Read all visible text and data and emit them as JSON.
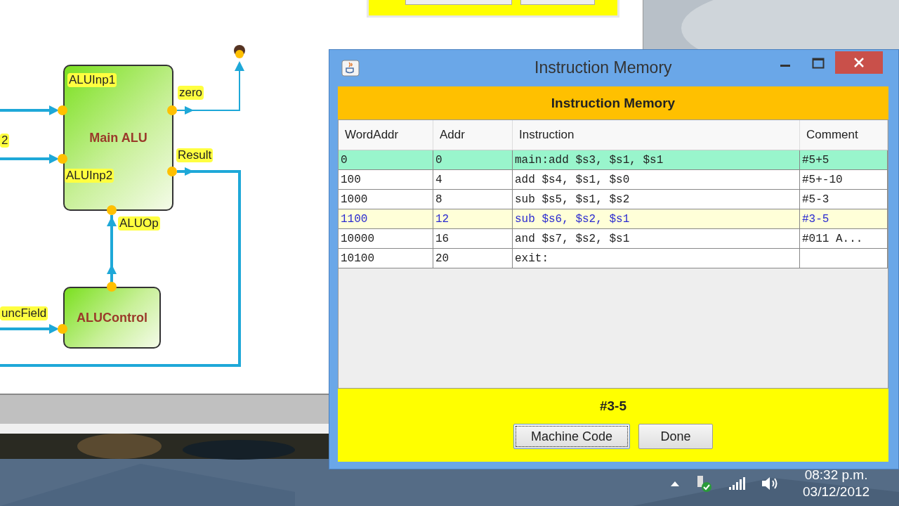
{
  "diagram": {
    "blocks": [
      {
        "label": "Main ALU"
      },
      {
        "label": "ALUControl"
      }
    ],
    "ports": [
      {
        "label": "2"
      },
      {
        "label": "ALUInp1"
      },
      {
        "label": "ALUInp2"
      },
      {
        "label": "zero"
      },
      {
        "label": "Result"
      },
      {
        "label": "ALUOp"
      },
      {
        "label": "uncField"
      }
    ]
  },
  "window": {
    "title": "Instruction Memory"
  },
  "header": "Instruction Memory",
  "table": {
    "columns": [
      "WordAddr",
      "Addr",
      "Instruction",
      "Comment"
    ],
    "rows": [
      {
        "cells": [
          "0",
          "0",
          "main:add $s3, $s1, $s1",
          "#5+5"
        ],
        "current": true,
        "selected": false
      },
      {
        "cells": [
          "100",
          "4",
          "add $s4, $s1, $s0",
          "#5+-10"
        ],
        "current": false,
        "selected": false
      },
      {
        "cells": [
          "1000",
          "8",
          "sub $s5, $s1, $s2",
          "#5-3"
        ],
        "current": false,
        "selected": false
      },
      {
        "cells": [
          "1100",
          "12",
          "sub $s6, $s2, $s1",
          "#3-5"
        ],
        "current": false,
        "selected": true
      },
      {
        "cells": [
          "10000",
          "16",
          "and $s7, $s2, $s1",
          "#011 A..."
        ],
        "current": false,
        "selected": false
      },
      {
        "cells": [
          "10100",
          "20",
          "exit:",
          ""
        ],
        "current": false,
        "selected": false
      }
    ]
  },
  "comment_display": "#3-5",
  "buttons": [
    {
      "label": "Machine Code",
      "focused": true
    },
    {
      "label": "Done",
      "focused": false
    }
  ],
  "taskbar": {
    "time": "08:32 p.m.",
    "date": "03/12/2012"
  }
}
